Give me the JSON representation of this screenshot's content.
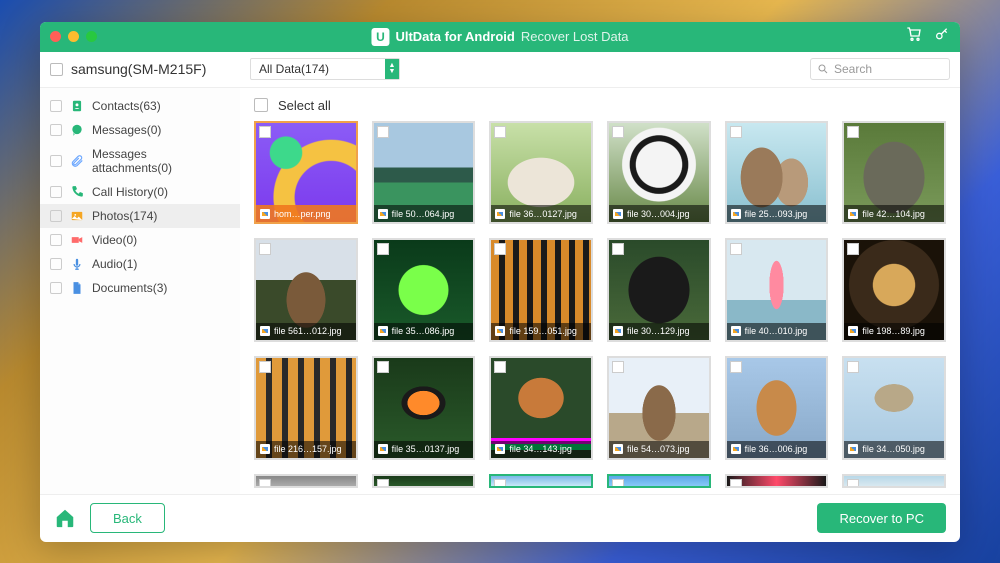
{
  "title": {
    "app": "UltData for Android",
    "sep": " – ",
    "sub": "Recover Lost Data",
    "logo_letter": "U"
  },
  "device": {
    "name": "samsung(SM-M215F)"
  },
  "filter": {
    "label": "All Data(174)"
  },
  "search": {
    "placeholder": "Search"
  },
  "select_all": "Select all",
  "sidebar": {
    "items": [
      {
        "label": "Contacts(63)",
        "icon": "contacts",
        "color": "#28b779"
      },
      {
        "label": "Messages(0)",
        "icon": "messages",
        "color": "#28b779"
      },
      {
        "label": "Messages attachments(0)",
        "icon": "attachment",
        "color": "#6aa6ff"
      },
      {
        "label": "Call History(0)",
        "icon": "phone",
        "color": "#28b779"
      },
      {
        "label": "Photos(174)",
        "icon": "photos",
        "color": "#f5a623",
        "active": true
      },
      {
        "label": "Video(0)",
        "icon": "video",
        "color": "#ff6b6b"
      },
      {
        "label": "Audio(1)",
        "icon": "audio",
        "color": "#4a90e2"
      },
      {
        "label": "Documents(3)",
        "icon": "document",
        "color": "#4a90e2"
      }
    ]
  },
  "photos": [
    {
      "name": "hom…per.png",
      "first": true,
      "bg": "radial-gradient(circle at 30% 30%, #3dd98b 0 16%, transparent 17%), radial-gradient(circle at 75% 75%, transparent 34%, #f5c242 35% 54%, transparent 55%), linear-gradient(#8b5cf6,#7c3aed)"
    },
    {
      "name": "file 50…064.jpg",
      "bg": "linear-gradient(180deg,#a8c8e0 0 45%, #2d5a4a 45% 60%, #3a945f 60% 100%)"
    },
    {
      "name": "file 36…0127.jpg",
      "bg": "radial-gradient(ellipse 60% 45% at 50% 60%, #ece5d8 0 55%, transparent 56%), linear-gradient(#c8e0a8,#8ab060)"
    },
    {
      "name": "file 30…004.jpg",
      "bg": "radial-gradient(circle at 50% 42%, #f4f4f4 0 30%, #1a1a1a 31% 38%, #f4f4f4 39% 48%, transparent 49%), linear-gradient(#d0e0c8,#6a8a4a)"
    },
    {
      "name": "file 25…093.jpg",
      "bg": "radial-gradient(ellipse 35% 50% at 35% 55%, #9a7a5a 0 60%, transparent 61%), radial-gradient(ellipse 28% 40% at 65% 60%, #b89a7a 0 60%, transparent 61%), linear-gradient(#c8e8f0,#8ac0d0)"
    },
    {
      "name": "file 42…104.jpg",
      "bg": "radial-gradient(ellipse 55% 65% at 50% 55%, #6a6a5a 0 55%, transparent 56%), linear-gradient(#5a7a3a,#7a9a5a)"
    },
    {
      "name": "file 561…012.jpg",
      "bg": "radial-gradient(ellipse 35% 50% at 50% 60%, #7a5a3a 0 55%, transparent 56%), linear-gradient(180deg,#d8e0e8 0 40%,#3a4a2a 40% 100%)"
    },
    {
      "name": "file 35…086.jpg",
      "bg": "radial-gradient(circle at 50% 50%, #7aff4a 0 35%, transparent 36%), linear-gradient(#0a3a1a,#1a5a2a)"
    },
    {
      "name": "file 159…051.jpg",
      "bg": "repeating-linear-gradient(90deg,#d88a2a 0 8px,#1a1a1a 8px 14px), radial-gradient(ellipse 60% 50% at 50% 45%, rgba(255,255,255,.2) 0 40%, transparent 41%)"
    },
    {
      "name": "file 30…129.jpg",
      "bg": "radial-gradient(ellipse 55% 60% at 50% 50%, #1a1a1a 0 55%, transparent 56%), linear-gradient(#2a4a2a,#4a6a3a)"
    },
    {
      "name": "file 40…010.jpg",
      "bg": "radial-gradient(ellipse 12% 40% at 50% 45%, #ff8aa0 0 60%, transparent 61%), linear-gradient(180deg,#d8e8f0 0 60%,#8ab8c8 60% 100%)"
    },
    {
      "name": "file 198…89.jpg",
      "bg": "radial-gradient(circle at 50% 45%, #d8a85a 0 28%, #3a2a1a 29% 60%, transparent 61%), #1a1208"
    },
    {
      "name": "file 216…157.jpg",
      "bg": "repeating-linear-gradient(90deg,#e09a3a 0 10px,#2a2a2a 10px 16px)"
    },
    {
      "name": "file 35…0137.jpg",
      "bg": "radial-gradient(ellipse 40% 30% at 50% 45%, #ff8a2a 0 40%, #1a1a1a 41% 55%, transparent 56%), linear-gradient(#1a3a1a,#2a5a2a)"
    },
    {
      "name": "file 34…143.jpg",
      "bg": "radial-gradient(ellipse 45% 40% at 50% 40%, #c87a3a 0 50%, transparent 51%), linear-gradient(180deg,#2a4a2a 0 80%, #ff00ff 80% 86%, #00ff7a 86% 92%, #2a4a2a 92% 100%)"
    },
    {
      "name": "file 54…073.jpg",
      "bg": "radial-gradient(ellipse 30% 50% at 50% 55%, #8a6a4a 0 55%, transparent 56%), linear-gradient(180deg,#e8f0f8 0 55%,#b8a88a 55% 100%)"
    },
    {
      "name": "file 36…006.jpg",
      "bg": "radial-gradient(ellipse 40% 55% at 50% 50%, #c88a4a 0 50%, transparent 51%), linear-gradient(#a8c8e8,#88a8c8)"
    },
    {
      "name": "file 34…050.jpg",
      "bg": "radial-gradient(ellipse 35% 25% at 50% 40%, #b8a888 0 55%, transparent 56%), linear-gradient(#c8e0f0,#a8c8e0)"
    },
    {
      "name": "",
      "partial": true,
      "bg": "linear-gradient(#888,#aaa)"
    },
    {
      "name": "",
      "partial": true,
      "bg": "linear-gradient(#1a3a1a,#2a5a2a)"
    },
    {
      "name": "",
      "partial": true,
      "sel": true,
      "bg": "linear-gradient(#7ab8e8,#c8e8f8)"
    },
    {
      "name": "",
      "partial": true,
      "sel": true,
      "bg": "linear-gradient(#5aa8e8,#88c8f8)"
    },
    {
      "name": "",
      "partial": true,
      "bg": "linear-gradient(90deg,#1a1a1a,#ff4a6a,#1a1a1a)"
    },
    {
      "name": "",
      "partial": true,
      "bg": "linear-gradient(#b8d8e8,#d8e8f0)"
    }
  ],
  "footer": {
    "back": "Back",
    "recover": "Recover to PC"
  }
}
